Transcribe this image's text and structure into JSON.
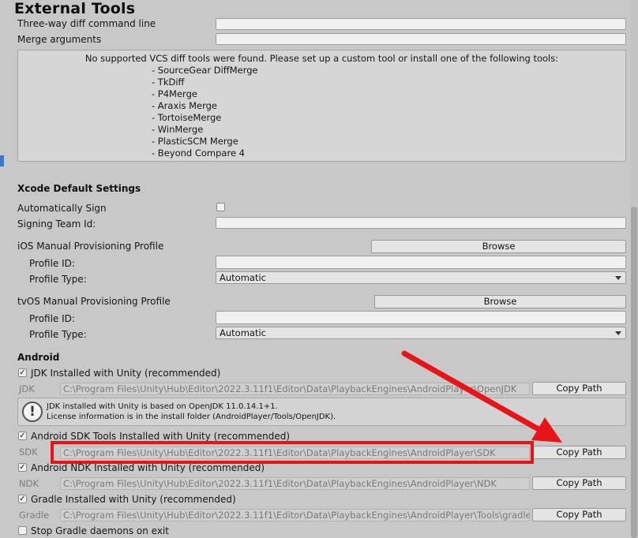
{
  "window": {
    "title": "External Tools"
  },
  "diff": {
    "three_way_label": "Three-way diff command line",
    "merge_label": "Merge arguments",
    "help_message": "No supported VCS diff tools were found. Please set up a custom tool or install one of the following tools:",
    "tools": [
      "- SourceGear DiffMerge",
      "- TkDiff",
      "- P4Merge",
      "- Araxis Merge",
      "- TortoiseMerge",
      "- WinMerge",
      "- PlasticSCM Merge",
      "- Beyond Compare 4"
    ]
  },
  "xcode": {
    "section_title": "Xcode Default Settings",
    "auto_sign_label": "Automatically Sign",
    "auto_sign_checked": false,
    "signing_team_label": "Signing Team Id:",
    "ios_profile_label": "iOS Manual Provisioning Profile",
    "tvos_profile_label": "tvOS Manual Provisioning Profile",
    "browse_label": "Browse",
    "profile_id_label": "Profile ID:",
    "profile_type_label": "Profile Type:",
    "profile_type_value": "Automatic"
  },
  "android": {
    "section_title": "Android",
    "copy_path_label": "Copy Path",
    "jdk": {
      "checkbox_label": "JDK Installed with Unity (recommended)",
      "checked": true,
      "field_label": "JDK",
      "path": "C:\\Program Files\\Unity\\Hub\\Editor\\2022.3.11f1\\Editor\\Data\\PlaybackEngines\\AndroidPlayer\\OpenJDK"
    },
    "jdk_info": {
      "line1": "JDK installed with Unity is based on OpenJDK 11.0.14.1+1.",
      "line2": "License information is in the install folder (AndroidPlayer/Tools/OpenJDK)."
    },
    "sdk": {
      "checkbox_label": "Android SDK Tools Installed with Unity (recommended)",
      "checked": true,
      "field_label": "SDK",
      "path": "C:\\Program Files\\Unity\\Hub\\Editor\\2022.3.11f1\\Editor\\Data\\PlaybackEngines\\AndroidPlayer\\SDK"
    },
    "ndk": {
      "checkbox_label": "Android NDK Installed with Unity (recommended)",
      "checked": true,
      "field_label": "NDK",
      "path": "C:\\Program Files\\Unity\\Hub\\Editor\\2022.3.11f1\\Editor\\Data\\PlaybackEngines\\AndroidPlayer\\NDK"
    },
    "gradle": {
      "checkbox_label": "Gradle Installed with Unity (recommended)",
      "checked": true,
      "field_label": "Gradle",
      "path": "C:\\Program Files\\Unity\\Hub\\Editor\\2022.3.11f1\\Editor\\Data\\PlaybackEngines\\AndroidPlayer\\Tools\\gradle"
    },
    "stop_gradle_label": "Stop Gradle daemons on exit",
    "stop_gradle_checked": false
  },
  "icons": {
    "check": "✓",
    "info": "!"
  },
  "colors": {
    "annotation_red": "#e8141a",
    "panel_bg": "#c8c8c8"
  }
}
